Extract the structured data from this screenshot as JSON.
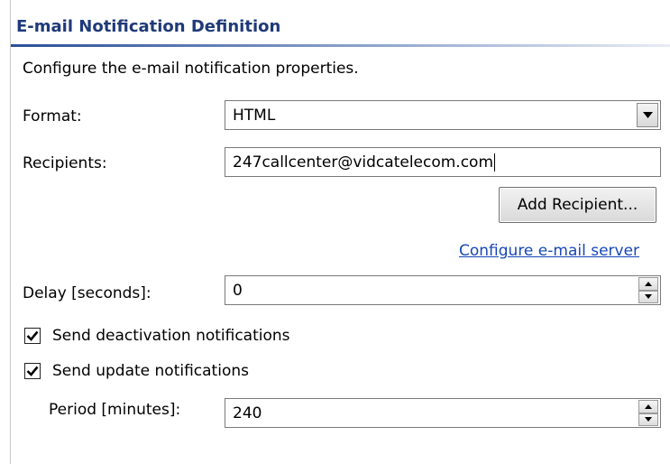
{
  "header": {
    "title": "E-mail Notification Definition",
    "description": "Configure the e-mail notification properties."
  },
  "format": {
    "label": "Format:",
    "value": "HTML",
    "icon": "chevron-down-icon"
  },
  "recipients": {
    "label": "Recipients:",
    "value": "247callcenter@vidcatelecom.com",
    "add_button": "Add Recipient...",
    "configure_link": "Configure e-mail server"
  },
  "delay": {
    "label": "Delay [seconds]:",
    "value": "0"
  },
  "deactivation": {
    "label": "Send deactivation notifications",
    "checked": true
  },
  "update": {
    "label": "Send update notifications",
    "checked": true
  },
  "period": {
    "label": "Period [minutes]:",
    "value": "240"
  },
  "colors": {
    "header_text": "#1f3a78",
    "link": "#1747b8",
    "field_border": "#7a7a7a"
  }
}
